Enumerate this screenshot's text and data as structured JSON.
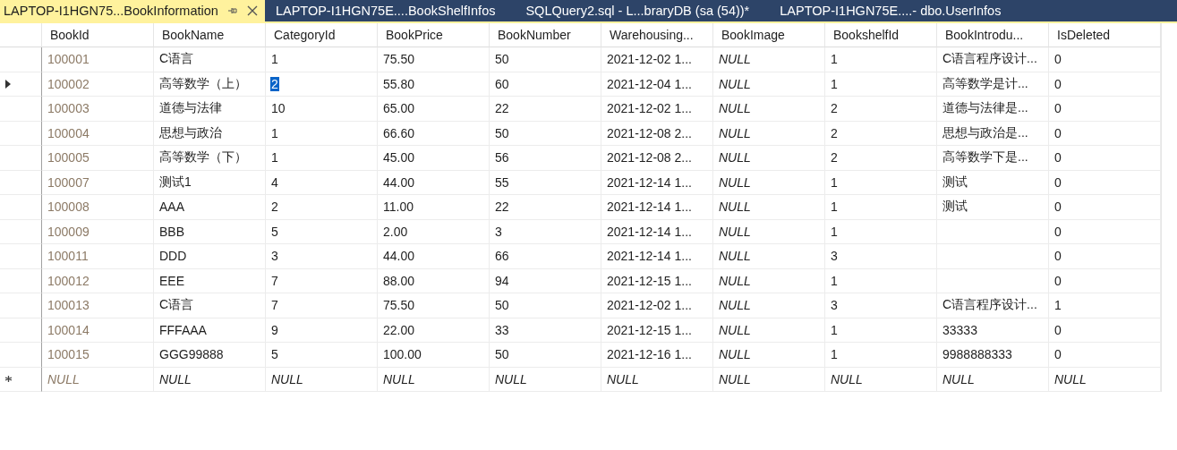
{
  "tabs": [
    {
      "label": "LAPTOP-I1HGN75...BookInformation",
      "selected": true,
      "pinnable": true
    },
    {
      "label": "LAPTOP-I1HGN75E....BookShelfInfos",
      "selected": false,
      "pinnable": false
    },
    {
      "label": "SQLQuery2.sql - L...braryDB (sa (54))*",
      "selected": false,
      "pinnable": false
    },
    {
      "label": "LAPTOP-I1HGN75E....- dbo.UserInfos",
      "selected": false,
      "pinnable": false
    }
  ],
  "grid": {
    "columns": [
      {
        "name": "BookId",
        "kind": "identity"
      },
      {
        "name": "BookName",
        "kind": "data"
      },
      {
        "name": "CategoryId",
        "kind": "data"
      },
      {
        "name": "BookPrice",
        "kind": "data"
      },
      {
        "name": "BookNumber",
        "kind": "data"
      },
      {
        "name": "Warehousing...",
        "kind": "data"
      },
      {
        "name": "BookImage",
        "kind": "data"
      },
      {
        "name": "BookshelfId",
        "kind": "data"
      },
      {
        "name": "BookIntrodu...",
        "kind": "data"
      },
      {
        "name": "IsDeleted",
        "kind": "data"
      }
    ],
    "rows": [
      {
        "current": false,
        "new_row": false,
        "cells": [
          "100001",
          "C语言",
          "1",
          "75.50",
          "50",
          "2021-12-02 1...",
          {
            "text": "NULL",
            "null": true
          },
          "1",
          "C语言程序设计...",
          "0"
        ]
      },
      {
        "current": true,
        "new_row": false,
        "cells": [
          "100002",
          "高等数学（上）",
          {
            "text": "2",
            "focused": true
          },
          "55.80",
          "60",
          "2021-12-04 1...",
          {
            "text": "NULL",
            "null": true
          },
          "1",
          "高等数学是计...",
          "0"
        ]
      },
      {
        "current": false,
        "new_row": false,
        "cells": [
          "100003",
          "道德与法律",
          "10",
          "65.00",
          "22",
          "2021-12-02 1...",
          {
            "text": "NULL",
            "null": true
          },
          "2",
          "道德与法律是...",
          "0"
        ]
      },
      {
        "current": false,
        "new_row": false,
        "cells": [
          "100004",
          "思想与政治",
          "1",
          "66.60",
          "50",
          "2021-12-08 2...",
          {
            "text": "NULL",
            "null": true
          },
          "2",
          "思想与政治是...",
          "0"
        ]
      },
      {
        "current": false,
        "new_row": false,
        "cells": [
          "100005",
          "高等数学（下）",
          "1",
          "45.00",
          "56",
          "2021-12-08 2...",
          {
            "text": "NULL",
            "null": true
          },
          "2",
          "高等数学下是...",
          "0"
        ]
      },
      {
        "current": false,
        "new_row": false,
        "cells": [
          "100007",
          "测试1",
          "4",
          "44.00",
          "55",
          "2021-12-14 1...",
          {
            "text": "NULL",
            "null": true
          },
          "1",
          "测试",
          "0"
        ]
      },
      {
        "current": false,
        "new_row": false,
        "cells": [
          "100008",
          "AAA",
          "2",
          "11.00",
          "22",
          "2021-12-14 1...",
          {
            "text": "NULL",
            "null": true
          },
          "1",
          "测试",
          "0"
        ]
      },
      {
        "current": false,
        "new_row": false,
        "cells": [
          "100009",
          "BBB",
          "5",
          "2.00",
          "3",
          "2021-12-14 1...",
          {
            "text": "NULL",
            "null": true
          },
          "1",
          null,
          "0"
        ]
      },
      {
        "current": false,
        "new_row": false,
        "cells": [
          "100011",
          "DDD",
          "3",
          "44.00",
          "66",
          "2021-12-14 1...",
          {
            "text": "NULL",
            "null": true
          },
          "3",
          null,
          "0"
        ]
      },
      {
        "current": false,
        "new_row": false,
        "cells": [
          "100012",
          "EEE",
          "7",
          "88.00",
          "94",
          "2021-12-15 1...",
          {
            "text": "NULL",
            "null": true
          },
          "1",
          null,
          "0"
        ]
      },
      {
        "current": false,
        "new_row": false,
        "cells": [
          "100013",
          "C语言",
          "7",
          "75.50",
          "50",
          "2021-12-02 1...",
          {
            "text": "NULL",
            "null": true
          },
          "3",
          "C语言程序设计...",
          "1"
        ]
      },
      {
        "current": false,
        "new_row": false,
        "cells": [
          "100014",
          "FFFAAA",
          "9",
          "22.00",
          "33",
          "2021-12-15 1...",
          {
            "text": "NULL",
            "null": true
          },
          "1",
          "33333",
          "0"
        ]
      },
      {
        "current": false,
        "new_row": false,
        "cells": [
          "100015",
          "GGG99888",
          "5",
          "100.00",
          "50",
          "2021-12-16 1...",
          {
            "text": "NULL",
            "null": true
          },
          "1",
          "9988888333",
          "0"
        ]
      },
      {
        "current": false,
        "new_row": true,
        "cells": [
          {
            "text": "NULL",
            "null": true
          },
          {
            "text": "NULL",
            "null": true
          },
          {
            "text": "NULL",
            "null": true
          },
          {
            "text": "NULL",
            "null": true
          },
          {
            "text": "NULL",
            "null": true
          },
          {
            "text": "NULL",
            "null": true
          },
          {
            "text": "NULL",
            "null": true
          },
          {
            "text": "NULL",
            "null": true
          },
          {
            "text": "NULL",
            "null": true
          },
          {
            "text": "NULL",
            "null": true
          }
        ]
      }
    ]
  }
}
